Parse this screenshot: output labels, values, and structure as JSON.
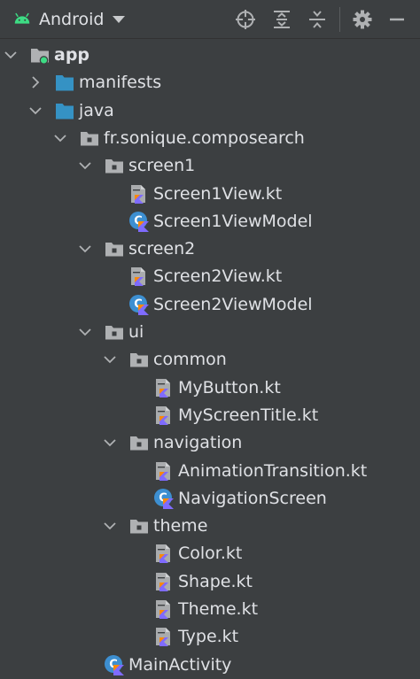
{
  "toolbar": {
    "view_label": "Android",
    "icons": [
      "android-icon",
      "chevron-down-icon",
      "locate-icon",
      "expand-all-icon",
      "collapse-all-icon",
      "gear-icon",
      "hide-icon"
    ],
    "colors": {
      "android": "#3ddc84",
      "icon": "#afb1b3",
      "background": "#3c3f41"
    }
  },
  "tree": {
    "items": [
      {
        "label": "app",
        "type": "module",
        "depth": 0,
        "expanded": true,
        "bold": true
      },
      {
        "label": "manifests",
        "type": "folder-blue",
        "depth": 1,
        "expanded": false
      },
      {
        "label": "java",
        "type": "folder-blue",
        "depth": 1,
        "expanded": true
      },
      {
        "label": "fr.sonique.composearch",
        "type": "package",
        "depth": 2,
        "expanded": true
      },
      {
        "label": "screen1",
        "type": "package",
        "depth": 3,
        "expanded": true
      },
      {
        "label": "Screen1View.kt",
        "type": "kotlin-file",
        "depth": 4
      },
      {
        "label": "Screen1ViewModel",
        "type": "kotlin-class",
        "depth": 4
      },
      {
        "label": "screen2",
        "type": "package",
        "depth": 3,
        "expanded": true
      },
      {
        "label": "Screen2View.kt",
        "type": "kotlin-file",
        "depth": 4
      },
      {
        "label": "Screen2ViewModel",
        "type": "kotlin-class",
        "depth": 4
      },
      {
        "label": "ui",
        "type": "package",
        "depth": 3,
        "expanded": true
      },
      {
        "label": "common",
        "type": "package",
        "depth": 4,
        "expanded": true
      },
      {
        "label": "MyButton.kt",
        "type": "kotlin-file",
        "depth": 5
      },
      {
        "label": "MyScreenTitle.kt",
        "type": "kotlin-file",
        "depth": 5
      },
      {
        "label": "navigation",
        "type": "package",
        "depth": 4,
        "expanded": true
      },
      {
        "label": "AnimationTransition.kt",
        "type": "kotlin-file",
        "depth": 5
      },
      {
        "label": "NavigationScreen",
        "type": "kotlin-class",
        "depth": 5
      },
      {
        "label": "theme",
        "type": "package",
        "depth": 4,
        "expanded": true
      },
      {
        "label": "Color.kt",
        "type": "kotlin-file",
        "depth": 5
      },
      {
        "label": "Shape.kt",
        "type": "kotlin-file",
        "depth": 5
      },
      {
        "label": "Theme.kt",
        "type": "kotlin-file",
        "depth": 5
      },
      {
        "label": "Type.kt",
        "type": "kotlin-file",
        "depth": 5
      },
      {
        "label": "MainActivity",
        "type": "kotlin-class",
        "depth": 3
      }
    ]
  }
}
